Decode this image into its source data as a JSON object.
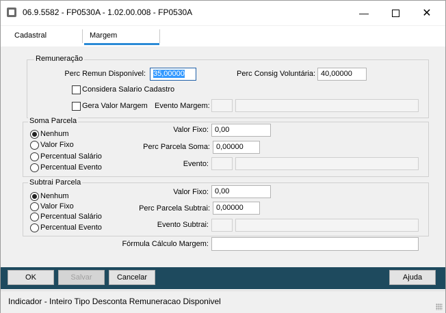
{
  "window": {
    "title": "06.9.5582 - FP0530A - 1.02.00.008 - FP0530A"
  },
  "tabs": [
    {
      "label": "Cadastral"
    },
    {
      "label": "Margem"
    }
  ],
  "remuneracao": {
    "legend": "Remuneração",
    "perc_remun_label": "Perc Remun Disponível:",
    "perc_remun_value": "35,00000",
    "perc_consig_label": "Perc Consig Voluntária:",
    "perc_consig_value": "40,00000",
    "considera_label": "Considera Salario Cadastro",
    "gera_label": "Gera Valor Margem",
    "evento_margem_label": "Evento Margem:"
  },
  "soma": {
    "legend": "Soma Parcela",
    "options": [
      "Nenhum",
      "Valor Fixo",
      "Percentual Salário",
      "Percentual Evento"
    ],
    "selected": "Nenhum",
    "valor_fixo_label": "Valor Fixo:",
    "valor_fixo_value": "0,00",
    "perc_parcela_label": "Perc Parcela Soma:",
    "perc_parcela_value": "0,00000",
    "evento_label": "Evento:"
  },
  "subtrai": {
    "legend": "Subtrai Parcela",
    "options": [
      "Nenhum",
      "Valor Fixo",
      "Percentual Salário",
      "Percentual Evento"
    ],
    "selected": "Nenhum",
    "valor_fixo_label": "Valor Fixo:",
    "valor_fixo_value": "0,00",
    "perc_parcela_label": "Perc Parcela Subtrai:",
    "perc_parcela_value": "0,00000",
    "evento_label": "Evento Subtrai:"
  },
  "formula": {
    "label": "Fórmula Cálculo Margem:",
    "value": ""
  },
  "buttons": {
    "ok": "OK",
    "salvar": "Salvar",
    "cancelar": "Cancelar",
    "ajuda": "Ajuda"
  },
  "status": {
    "text": "Indicador - Inteiro Tipo Desconta Remuneracao Disponivel"
  }
}
